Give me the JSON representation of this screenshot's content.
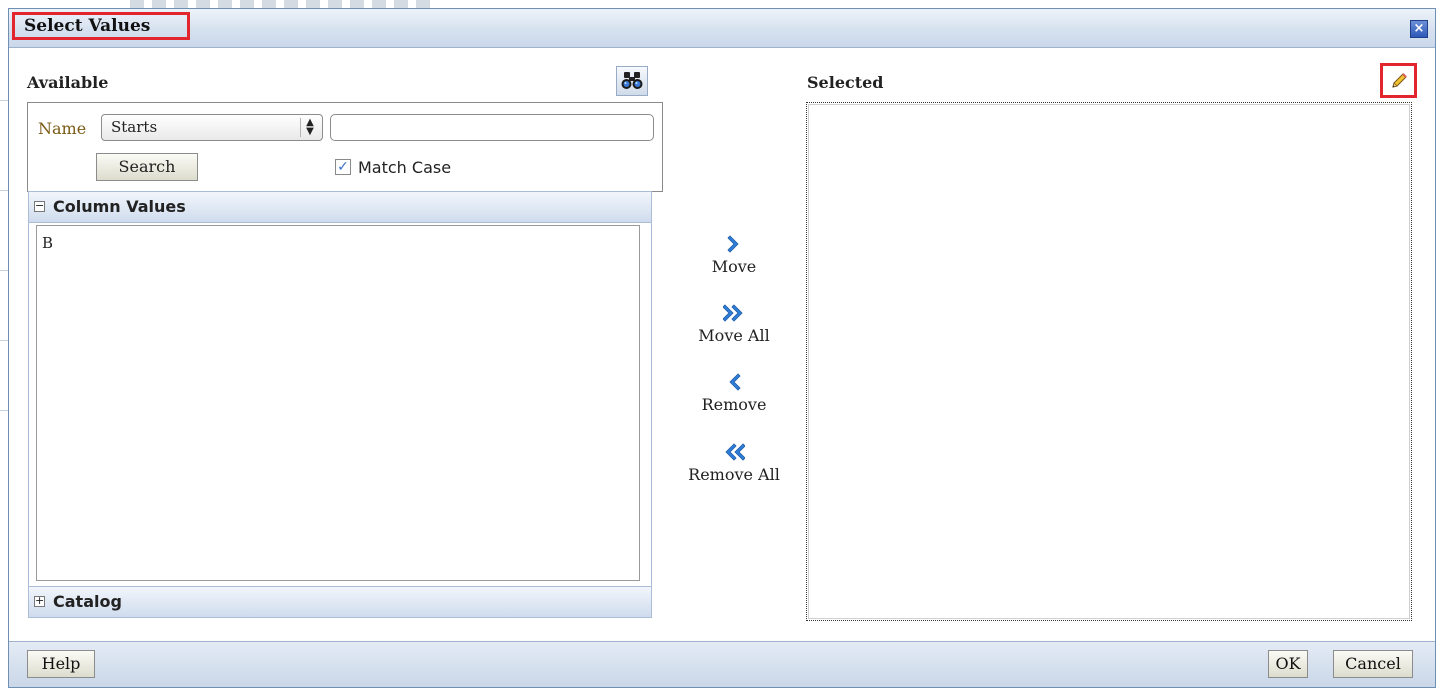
{
  "dialog": {
    "title": "Select Values",
    "close_label": "×"
  },
  "available": {
    "label": "Available",
    "name_label": "Name",
    "operator_value": "Starts",
    "search_value": "",
    "search_button": "Search",
    "match_case_label": "Match Case",
    "match_case_checked": true,
    "column_values_header": "Column Values",
    "values": [
      "B"
    ],
    "catalog_header": "Catalog"
  },
  "shuttle": {
    "move": "Move",
    "move_all": "Move All",
    "remove": "Remove",
    "remove_all": "Remove All"
  },
  "selected": {
    "label": "Selected",
    "values": []
  },
  "footer": {
    "help": "Help",
    "ok": "OK",
    "cancel": "Cancel"
  },
  "colors": {
    "highlight_red": "#e3262e",
    "icon_blue": "#2f7fd8",
    "title_gradient": "#d6e1ef"
  },
  "icons": [
    "binoculars-icon",
    "pencil-icon",
    "close-icon",
    "move-icon",
    "move-all-icon",
    "remove-icon",
    "remove-all-icon"
  ]
}
